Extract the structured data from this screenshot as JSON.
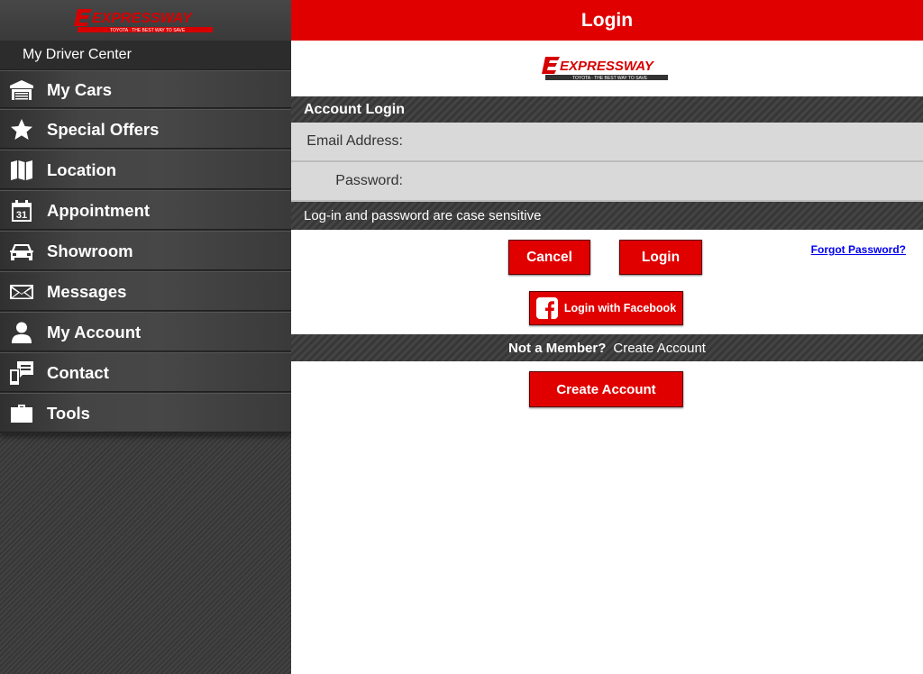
{
  "brand": {
    "logo_text": "EXPRESSWAY",
    "logo_tagline": "TOYOTA · THE BEST WAY TO SAVE",
    "accent": "#e00000"
  },
  "sidebar": {
    "section_title": "My Driver Center",
    "items": [
      {
        "label": "My Cars",
        "icon": "garage-icon"
      },
      {
        "label": "Special Offers",
        "icon": "star-icon"
      },
      {
        "label": "Location",
        "icon": "map-icon"
      },
      {
        "label": "Appointment",
        "icon": "calendar-icon",
        "icon_text": "31"
      },
      {
        "label": "Showroom",
        "icon": "car-icon"
      },
      {
        "label": "Messages",
        "icon": "envelope-icon"
      },
      {
        "label": "My Account",
        "icon": "person-icon"
      },
      {
        "label": "Contact",
        "icon": "phone-icon"
      },
      {
        "label": "Tools",
        "icon": "toolbox-icon"
      }
    ]
  },
  "header": {
    "title": "Login"
  },
  "login": {
    "section_title": "Account Login",
    "email_label": "Email Address:",
    "email_value": "",
    "password_label": "Password:",
    "password_value": "",
    "case_note": "Log-in and password are case sensitive",
    "cancel_label": "Cancel",
    "login_label": "Login",
    "forgot_label": "Forgot Password?",
    "facebook_label": "Login with Facebook"
  },
  "signup": {
    "question": "Not a Member?",
    "prompt": "Create Account",
    "button_label": "Create Account"
  }
}
